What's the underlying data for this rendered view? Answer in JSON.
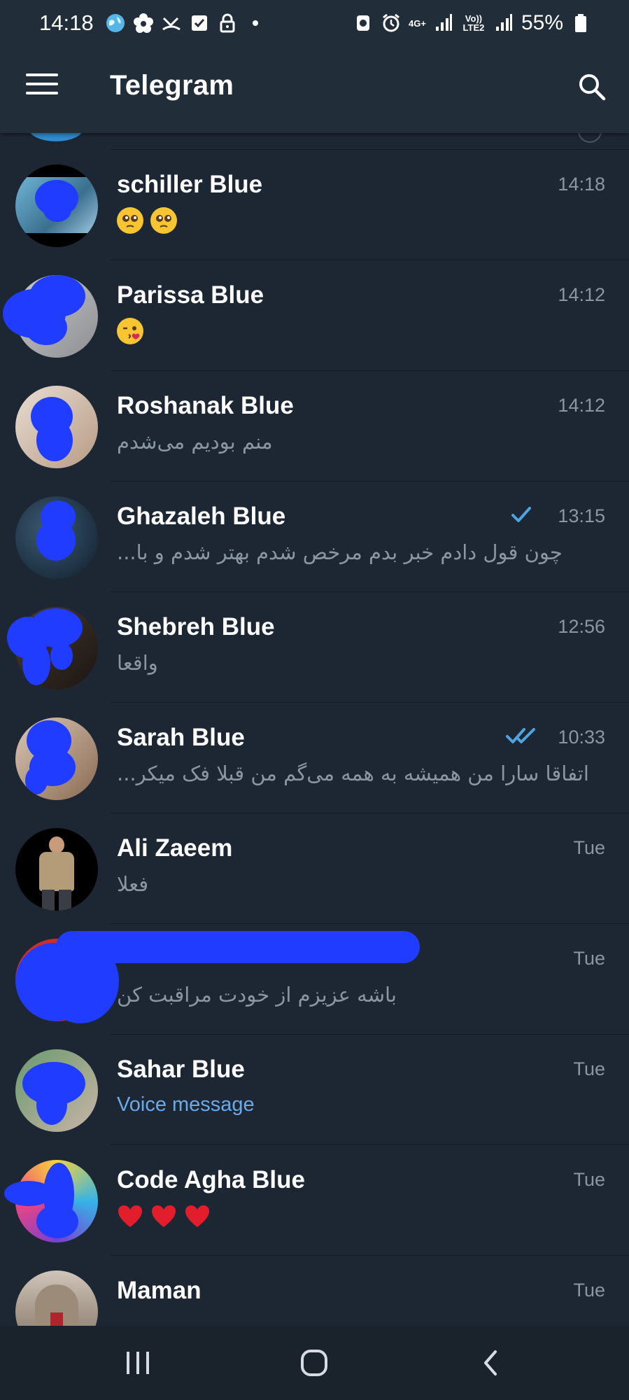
{
  "status_bar": {
    "time": "14:18",
    "network": "4G+",
    "volte": "Vo)) LTE2",
    "battery": "55%"
  },
  "toolbar": {
    "title": "Telegram",
    "menu_icon": "hamburger-menu-icon",
    "search_icon": "search-icon"
  },
  "chats": [
    {
      "name": "schiller Blue",
      "time": "14:18",
      "preview": "🥺🥺",
      "preview_kind": "emoji-pleading",
      "read_status": "none"
    },
    {
      "name": "Parissa Blue",
      "time": "14:12",
      "preview": "😘",
      "preview_kind": "emoji-kiss",
      "read_status": "none"
    },
    {
      "name": "Roshanak Blue",
      "time": "14:12",
      "preview": "منم بودیم می‌شدم",
      "preview_kind": "text-rtl",
      "read_status": "none"
    },
    {
      "name": "Ghazaleh Blue",
      "time": "13:15",
      "preview": "چون قول دادم خبر بدم مرخص شدم  بهتر شدم و با...",
      "preview_kind": "text-rtl",
      "read_status": "sent"
    },
    {
      "name": "Shebreh Blue",
      "time": "12:56",
      "preview": "واقعا",
      "preview_kind": "text-rtl",
      "read_status": "none"
    },
    {
      "name": "Sarah Blue",
      "time": "10:33",
      "preview": "اتفاقا سارا من همیشه به همه می‌گم من قبلا فک میکر...",
      "preview_kind": "text-rtl",
      "read_status": "read"
    },
    {
      "name": "Ali Zaeem",
      "time": "Tue",
      "preview": "فعلا",
      "preview_kind": "text-rtl",
      "read_status": "none"
    },
    {
      "name": "",
      "time": "Tue",
      "preview": "باشه عزیزم از خودت مراقبت کن",
      "preview_kind": "text-rtl",
      "read_status": "none"
    },
    {
      "name": "Sahar Blue",
      "time": "Tue",
      "preview": "Voice message",
      "preview_kind": "voice",
      "read_status": "none"
    },
    {
      "name": "Code Agha Blue",
      "time": "Tue",
      "preview": "❤️❤️❤️",
      "preview_kind": "emoji-hearts",
      "read_status": "none"
    },
    {
      "name": "Maman",
      "time": "Tue",
      "preview": "",
      "preview_kind": "text-rtl",
      "read_status": "none"
    }
  ],
  "colors": {
    "background": "#1d2733",
    "header": "#222d3a",
    "accent_blue": "#6aaaea",
    "check_blue": "#4fa3e0",
    "secondary_text": "#8b96a3",
    "scribble_blue": "#1f3cff"
  },
  "navbar": {
    "recents_icon": "recent-apps-icon",
    "home_icon": "home-icon",
    "back_icon": "back-icon"
  }
}
